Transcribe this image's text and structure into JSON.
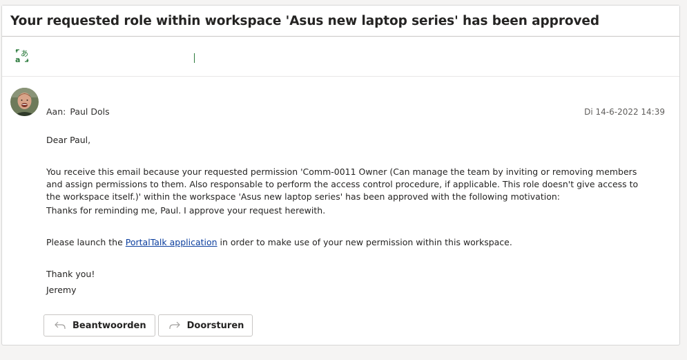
{
  "email": {
    "subject": "Your requested role within workspace 'Asus new laptop series' has been approved",
    "to_label": "Aan:",
    "to_name": "Paul Dols",
    "date": "Di 14-6-2022 14:39",
    "greeting": "Dear Paul,",
    "paragraph1": "You receive this email because your requested permission 'Comm-0011 Owner (Can manage the team by inviting or removing members and assign permissions to them. Also responsable to perform the access control procedure, if applicable. This role doesn't give access to the workspace itself.)' within the workspace 'Asus new laptop series' has been approved with the following motivation:",
    "motivation": "Thanks for reminding me, Paul. I approve your request herewith.",
    "launch_prefix": "Please launch the ",
    "launch_link": "PortalTalk application",
    "launch_suffix": " in order to make use of your new permission within this workspace.",
    "thanks": "Thank you!",
    "signature": "Jeremy"
  },
  "actions": {
    "reply_label": "Beantwoorden",
    "forward_label": "Doorsturen"
  },
  "icons": {
    "translate": "translate-icon",
    "reply": "reply-arrow-icon",
    "forward": "forward-arrow-icon"
  },
  "colors": {
    "link": "#0b3e9e",
    "translate_green": "#2b7a3c"
  }
}
